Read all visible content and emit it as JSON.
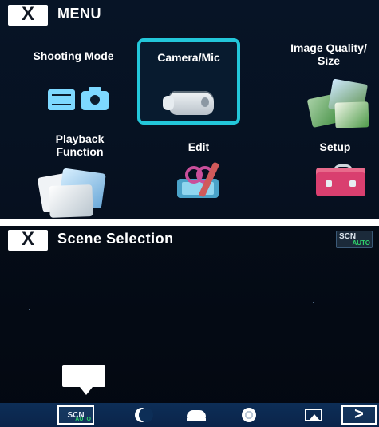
{
  "menu": {
    "close_label": "X",
    "title": "MENU",
    "tiles": {
      "shooting_mode": "Shooting Mode",
      "camera_mic": "Camera/Mic",
      "image_quality_1": "Image Quality/",
      "image_quality_2": "Size",
      "playback_1": "Playback",
      "playback_2": "Function",
      "edit": "Edit",
      "setup": "Setup"
    }
  },
  "scene_selection": {
    "close_label": "X",
    "title": "Scene Selection",
    "badge_scn": "SCN",
    "badge_auto": "AUTO",
    "bar": {
      "selected_scn": "SCN",
      "selected_auto": "AUTO",
      "next_label": ">"
    }
  }
}
